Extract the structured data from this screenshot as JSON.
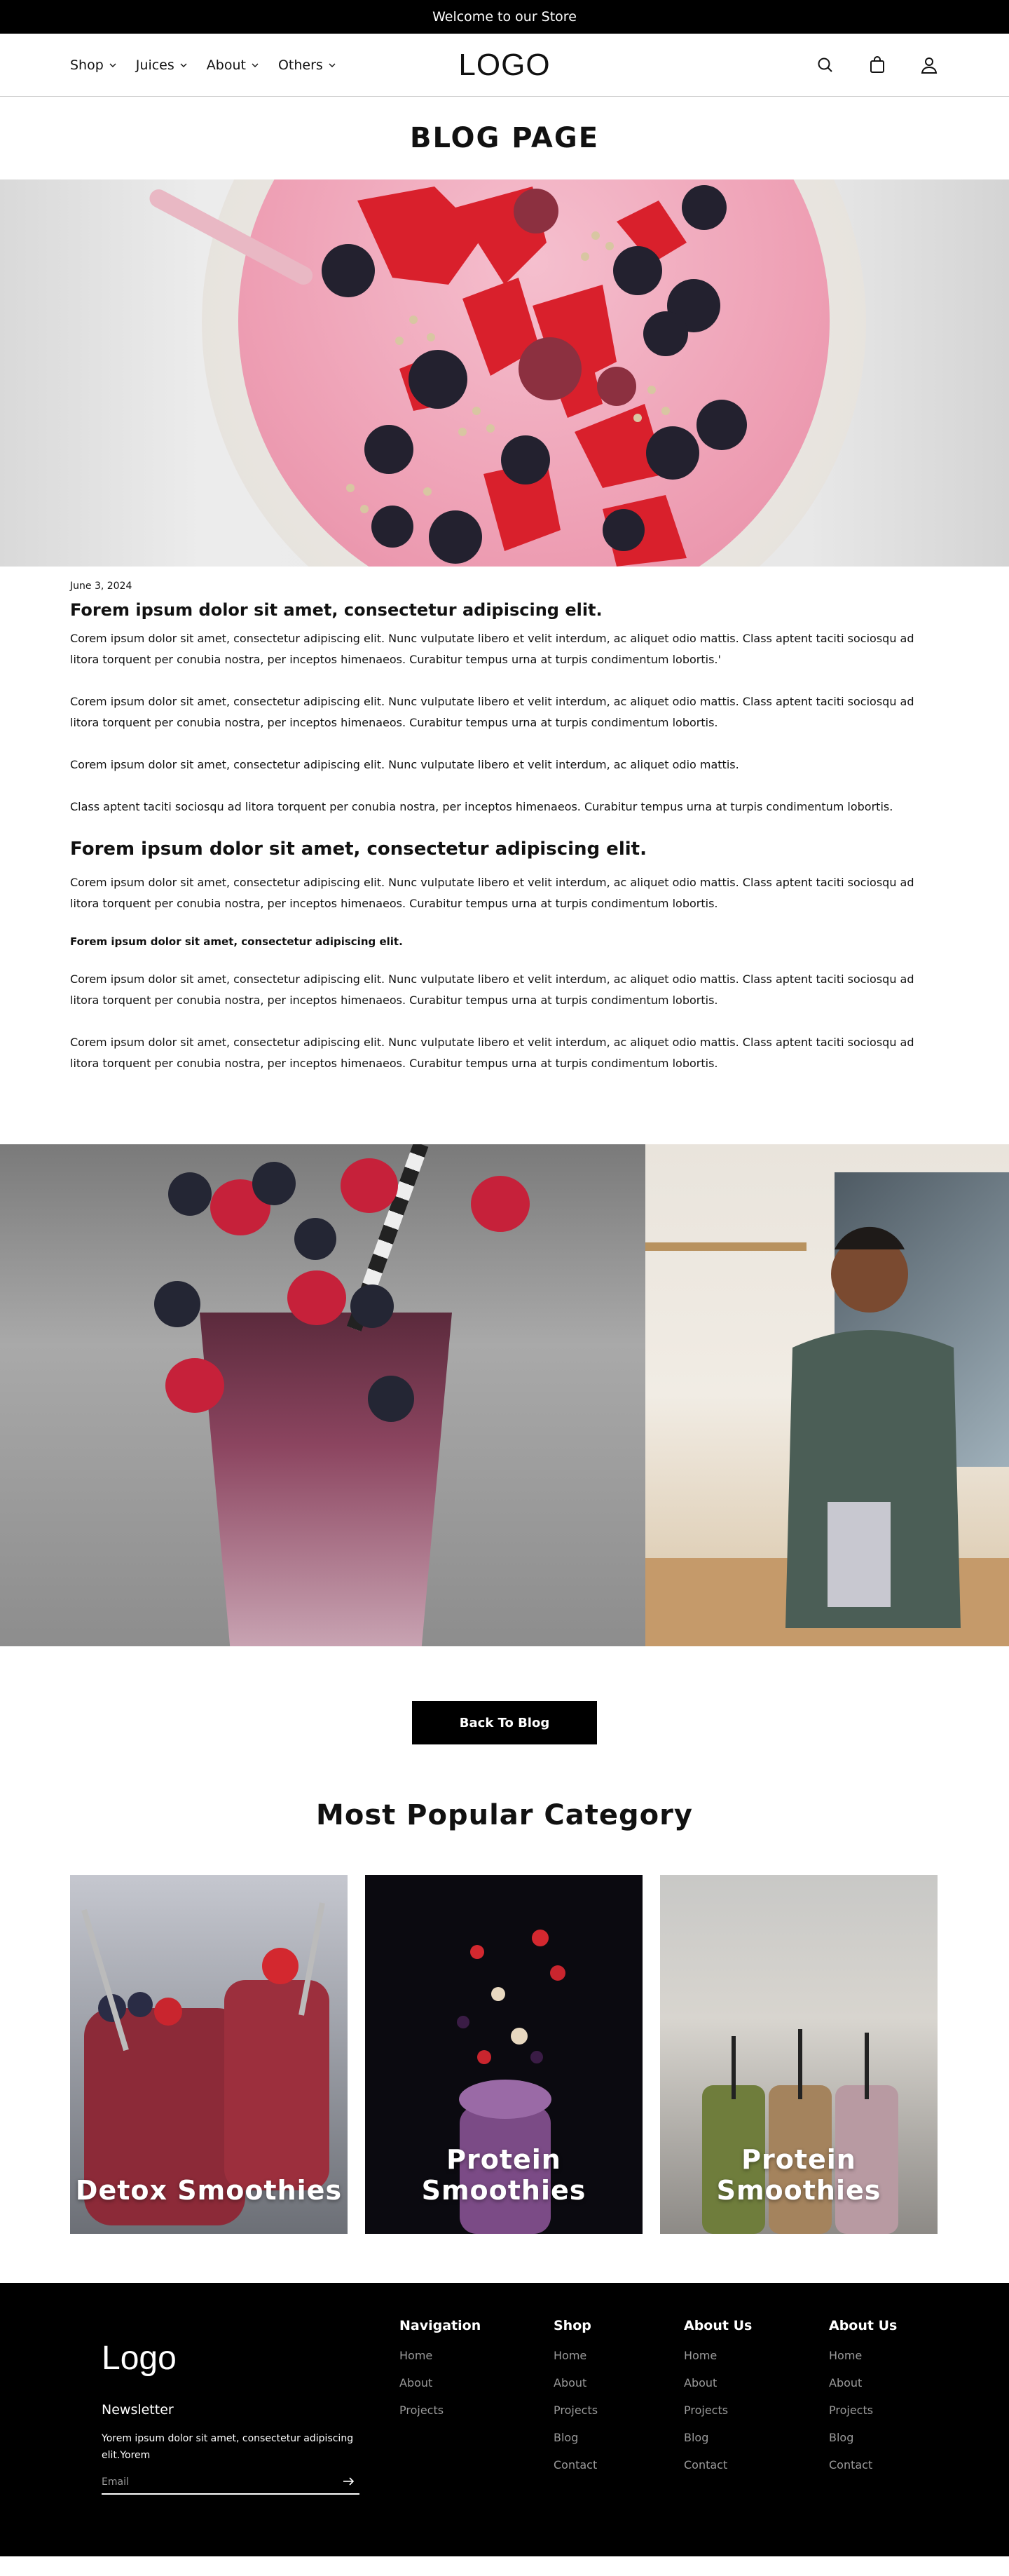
{
  "announcement": "Welcome to our Store",
  "header": {
    "logo": "LOGO",
    "nav": [
      {
        "label": "Shop"
      },
      {
        "label": "Juices"
      },
      {
        "label": "About"
      },
      {
        "label": "Others"
      }
    ],
    "icons": [
      "search-icon",
      "bag-icon",
      "user-icon"
    ]
  },
  "page_title": "BLOG PAGE",
  "article": {
    "date": "June 3, 2024",
    "heading": "Forem ipsum dolor sit amet, consectetur adipiscing elit.",
    "paragraphs_1": [
      "Corem ipsum dolor sit amet, consectetur adipiscing elit. Nunc vulputate libero et velit interdum, ac aliquet odio mattis. Class aptent taciti sociosqu ad litora torquent per conubia nostra, per inceptos himenaeos. Curabitur tempus urna at turpis condimentum lobortis.'",
      "Corem ipsum dolor sit amet, consectetur adipiscing elit. Nunc vulputate libero et velit interdum, ac aliquet odio mattis. Class aptent taciti sociosqu ad litora torquent per conubia nostra, per inceptos himenaeos. Curabitur tempus urna at turpis condimentum lobortis.",
      "Corem ipsum dolor sit amet, consectetur adipiscing elit. Nunc vulputate libero et velit interdum, ac aliquet odio mattis.",
      "Class aptent taciti sociosqu ad litora torquent per conubia nostra, per inceptos himenaeos. Curabitur tempus urna at turpis condimentum lobortis."
    ],
    "subheading": "Forem ipsum dolor sit amet, consectetur adipiscing elit.",
    "paragraph_2": "Corem ipsum dolor sit amet, consectetur adipiscing elit. Nunc vulputate libero et velit interdum, ac aliquet odio mattis. Class aptent taciti sociosqu ad litora torquent per conubia nostra, per inceptos himenaeos. Curabitur tempus urna at turpis condimentum lobortis.",
    "bold_line": "Forem ipsum dolor sit amet, consectetur adipiscing elit.",
    "paragraphs_3": [
      "Corem ipsum dolor sit amet, consectetur adipiscing elit. Nunc vulputate libero et velit interdum, ac aliquet odio mattis. Class aptent taciti sociosqu ad litora torquent per conubia nostra, per inceptos himenaeos. Curabitur tempus urna at turpis condimentum lobortis.",
      "Corem ipsum dolor sit amet, consectetur adipiscing elit. Nunc vulputate libero et velit interdum, ac aliquet odio mattis. Class aptent taciti sociosqu ad litora torquent per conubia nostra, per inceptos himenaeos. Curabitur tempus urna at turpis condimentum lobortis."
    ]
  },
  "back_button": "Back To Blog",
  "categories": {
    "title": "Most Popular Category",
    "items": [
      {
        "label": "Detox Smoothies"
      },
      {
        "label": "Protein Smoothies"
      },
      {
        "label": "Protein Smoothies"
      }
    ]
  },
  "footer": {
    "logo": "Logo",
    "newsletter_title": "Newsletter",
    "newsletter_text": "Yorem ipsum dolor sit amet, consectetur adipiscing elit.Yorem",
    "email_placeholder": "Email",
    "columns": [
      {
        "title": "Navigation",
        "links": [
          "Home",
          "About",
          "Projects"
        ]
      },
      {
        "title": "Shop",
        "links": [
          "Home",
          "About",
          "Projects",
          "Blog",
          "Contact"
        ]
      },
      {
        "title": "About Us",
        "links": [
          "Home",
          "About",
          "Projects",
          "Blog",
          "Contact"
        ]
      },
      {
        "title": "About Us",
        "links": [
          "Home",
          "About",
          "Projects",
          "Blog",
          "Contact"
        ]
      }
    ]
  },
  "colors": {
    "primary": "#000000",
    "background": "#ffffff",
    "footer_link": "#9a9a9a"
  }
}
